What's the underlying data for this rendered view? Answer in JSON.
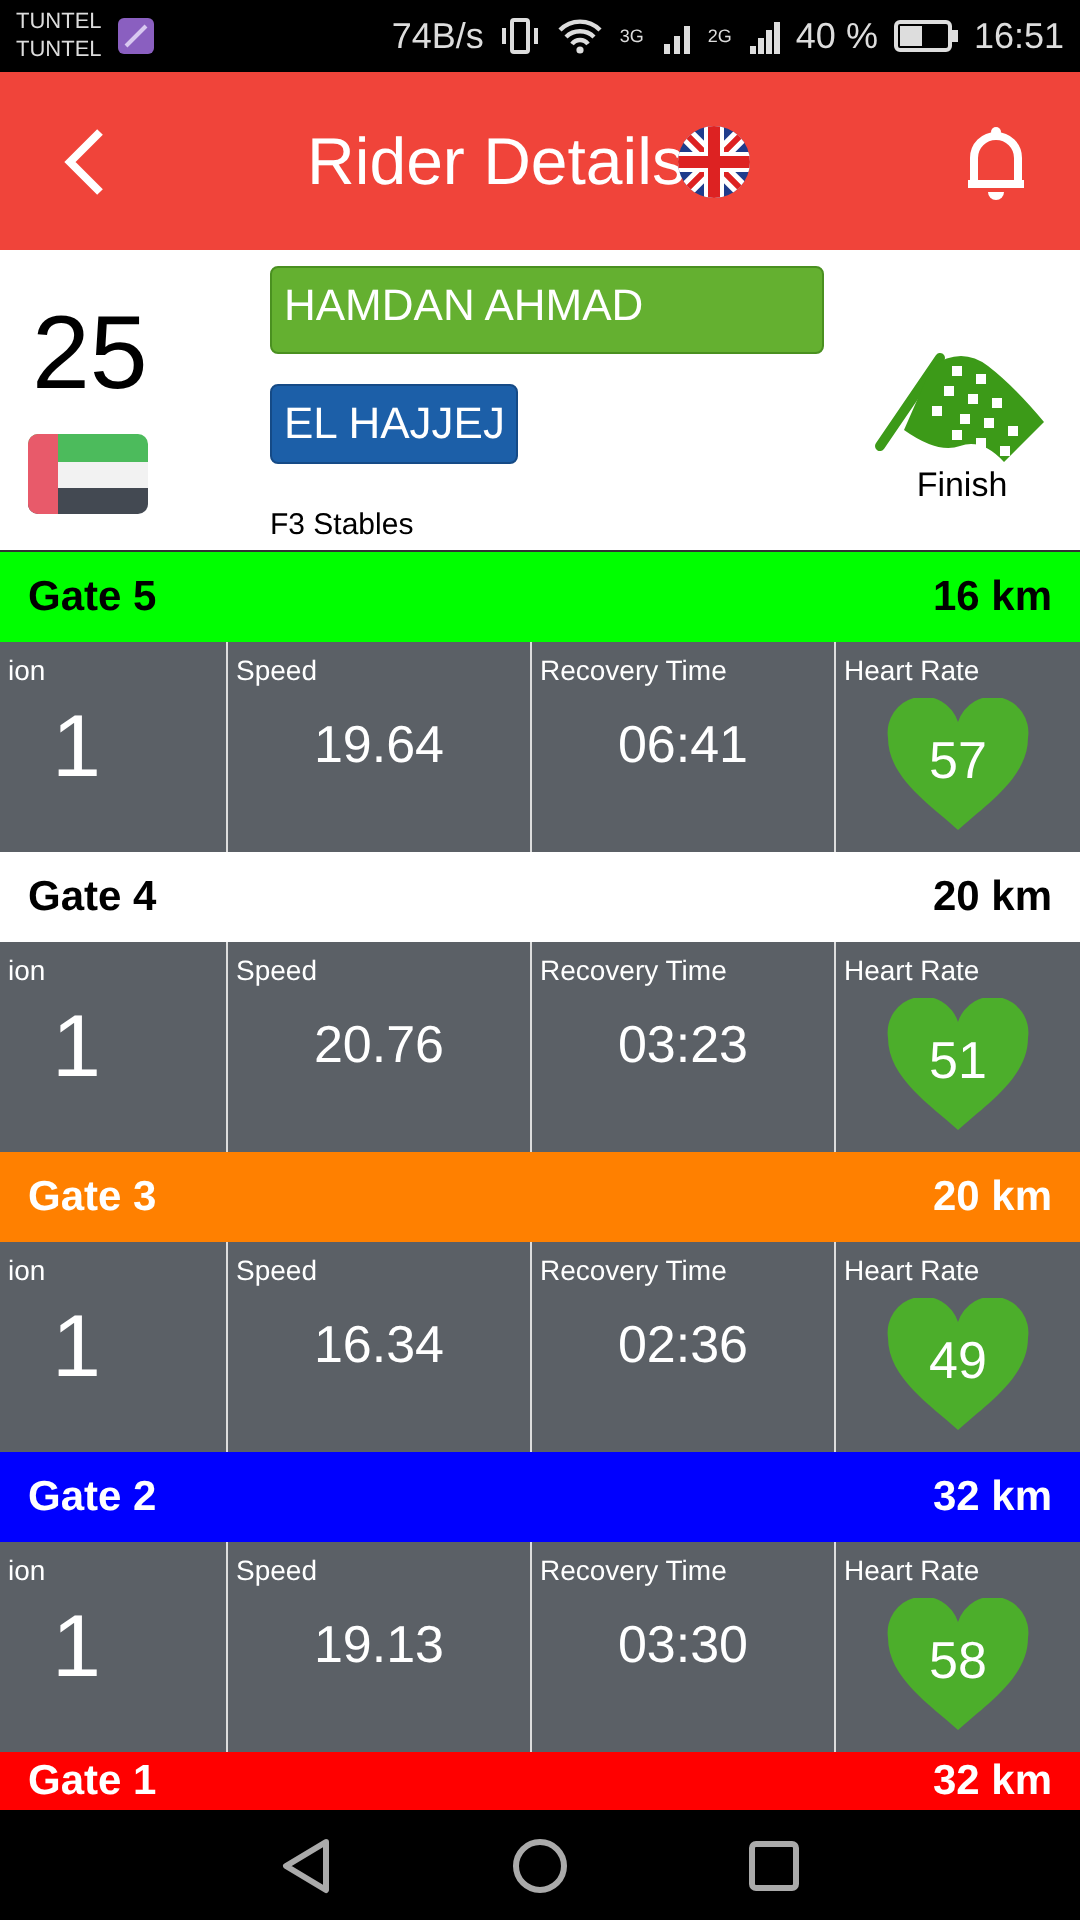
{
  "status_bar": {
    "carriers": [
      "TUNTEL",
      "TUNTEL"
    ],
    "speed": "74B/s",
    "network_1": "3G",
    "network_2": "2G",
    "battery": "40 %",
    "time": "16:51"
  },
  "header": {
    "title": "Rider Details"
  },
  "rider": {
    "number": "25",
    "name": "HAMDAN AHMAD",
    "trainer": "EL HAJJEJ",
    "stable": "F3 Stables",
    "status": "Finish"
  },
  "gates": [
    {
      "name": "Gate 5",
      "distance": "16 km",
      "color": "#00ff00",
      "stats": [
        {
          "label": "ion",
          "value": "1"
        },
        {
          "label": "Speed",
          "value": "19.64"
        },
        {
          "label": "Recovery Time",
          "value": "06:41"
        },
        {
          "label": "Heart Rate",
          "value": "57"
        }
      ]
    },
    {
      "name": "Gate 4",
      "distance": "20 km",
      "color": "#ffffff",
      "stats": [
        {
          "label": "ion",
          "value": "1"
        },
        {
          "label": "Speed",
          "value": "20.76"
        },
        {
          "label": "Recovery Time",
          "value": "03:23"
        },
        {
          "label": "Heart Rate",
          "value": "51"
        }
      ]
    },
    {
      "name": "Gate 3",
      "distance": "20 km",
      "color": "#ff8000",
      "stats": [
        {
          "label": "ion",
          "value": "1"
        },
        {
          "label": "Speed",
          "value": "16.34"
        },
        {
          "label": "Recovery Time",
          "value": "02:36"
        },
        {
          "label": "Heart Rate",
          "value": "49"
        }
      ]
    },
    {
      "name": "Gate 2",
      "distance": "32 km",
      "color": "#0000ff",
      "stats": [
        {
          "label": "ion",
          "value": "1"
        },
        {
          "label": "Speed",
          "value": "19.13"
        },
        {
          "label": "Recovery Time",
          "value": "03:30"
        },
        {
          "label": "Heart Rate",
          "value": "58"
        }
      ]
    },
    {
      "name": "Gate 1",
      "distance": "32 km",
      "color": "#ff0000"
    }
  ]
}
